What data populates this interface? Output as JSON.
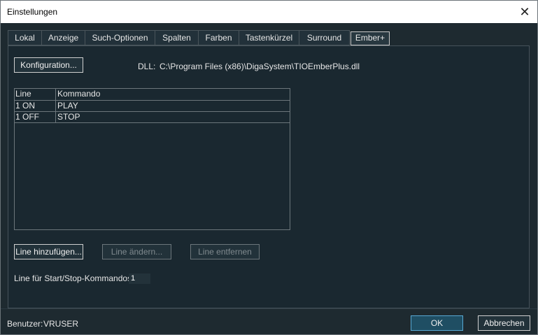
{
  "window": {
    "title": "Einstellungen"
  },
  "tabs": [
    {
      "label": "Lokal"
    },
    {
      "label": "Anzeige"
    },
    {
      "label": "Such-Optionen"
    },
    {
      "label": "Spalten"
    },
    {
      "label": "Farben"
    },
    {
      "label": "Tastenkürzel"
    },
    {
      "label": "Surround"
    },
    {
      "label": "Ember+"
    }
  ],
  "active_tab": "Ember+",
  "ember": {
    "config_button": "Konfiguration...",
    "dll_label": "DLL:",
    "dll_path": "C:\\Program Files (x86)\\DigaSystem\\TIOEmberPlus.dll",
    "table": {
      "headers": [
        "Line",
        "Kommando"
      ],
      "rows": [
        {
          "line": "1 ON",
          "command": "PLAY"
        },
        {
          "line": "1 OFF",
          "command": "STOP"
        }
      ]
    },
    "add_button": "Line hinzufügen...",
    "edit_button": "Line ändern...",
    "remove_button": "Line entfernen",
    "start_stop_label": "Line für Start/Stop-Kommandos",
    "start_stop_value": "1"
  },
  "footer": {
    "user_label": "Benutzer:",
    "user_value": "VRUSER",
    "ok_button": "OK",
    "cancel_button": "Abbrechen"
  }
}
